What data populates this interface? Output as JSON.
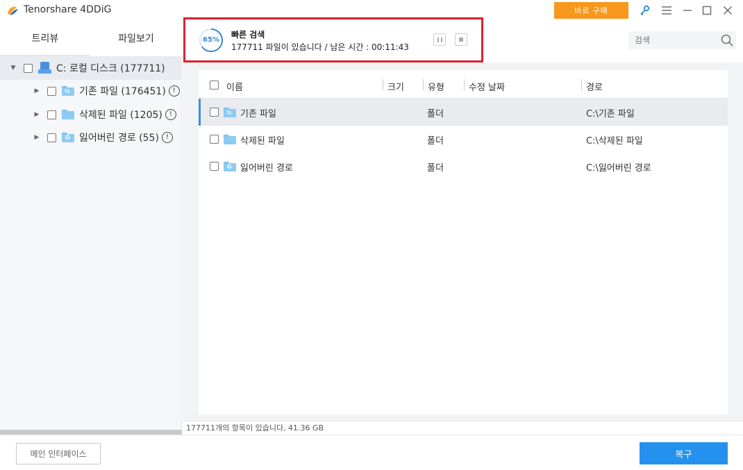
{
  "app": {
    "title": "Tenorshare 4DDiG",
    "buy_label": "바로 구매"
  },
  "view_tabs": [
    {
      "label": "트리뷰"
    },
    {
      "label": "파일보기"
    }
  ],
  "tree": {
    "root_label": "C: 로컬 디스크 (177711)",
    "children": [
      {
        "label": "기존 파일 (176451)"
      },
      {
        "label": "삭제된 파일 (1205)"
      },
      {
        "label": "잃어버린 경로 (55)"
      }
    ]
  },
  "scan": {
    "progress_text": "65%",
    "progress_value": 65,
    "title": "빠른 검색",
    "status": "177711 파일이 있습니다 /  남은 시간 : 00:11:43"
  },
  "search": {
    "placeholder": "검색"
  },
  "columns": {
    "name": "이름",
    "size": "크기",
    "type": "유형",
    "modified": "수정 날짜",
    "path": "경로"
  },
  "files": [
    {
      "name": "기존 파일",
      "size": "",
      "type": "폴더",
      "modified": "",
      "path": "C:\\기존 파일"
    },
    {
      "name": "삭제된 파일",
      "size": "",
      "type": "폴더",
      "modified": "",
      "path": "C:\\삭제된 파일"
    },
    {
      "name": "잃어버린 경로",
      "size": "",
      "type": "폴더",
      "modified": "",
      "path": "C:\\잃어버린 경로"
    }
  ],
  "status_bar": {
    "text": "177711개의 항목이 있습니다, 41.36 GB"
  },
  "buttons": {
    "main_interface": "메인 인터페이스",
    "recover": "복구"
  },
  "colors": {
    "accent": "#2591ee",
    "buy": "#f7981d",
    "highlight": "#e0202e",
    "progress": "#3a86d8"
  }
}
